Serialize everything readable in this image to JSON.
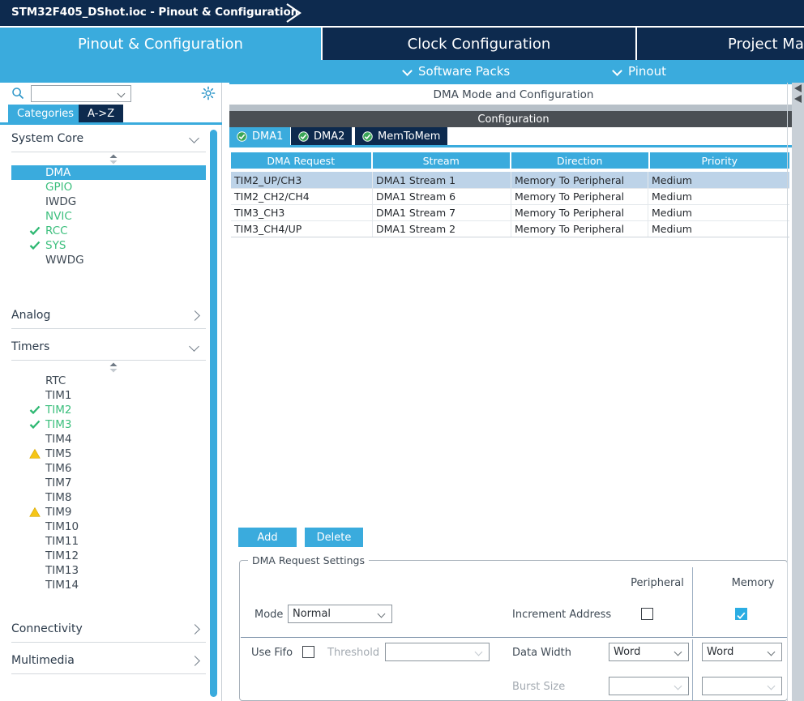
{
  "window": {
    "title": "STM32F405_DShot.ioc - Pinout & Configuration",
    "breadcrumb_icon": "chevron-right-icon"
  },
  "colors": {
    "brand_blue": "#3aabdd",
    "navy": "#0d2a4e",
    "selected_row": "#bdd3e8",
    "ok_green": "#3cbf7d",
    "warn_yellow": "#f5c518",
    "checkbox_checked": "#2bade3"
  },
  "main_tabs": [
    {
      "label": "Pinout & Configuration",
      "active": true
    },
    {
      "label": "Clock Configuration",
      "active": false
    },
    {
      "label": "Project Ma",
      "active": false
    }
  ],
  "sub_bar": [
    {
      "label": "Software Packs",
      "icon": "chevron-down-icon"
    },
    {
      "label": "Pinout",
      "icon": "chevron-down-icon"
    }
  ],
  "sidebar": {
    "search": {
      "value": "",
      "placeholder": "",
      "icon": "search-icon",
      "caret": "chevron-down-icon"
    },
    "settings_icon": "gear-icon",
    "view_tabs": [
      {
        "label": "Categories",
        "active": true
      },
      {
        "label": "A->Z",
        "active": false
      }
    ],
    "groups": [
      {
        "title": "System Core",
        "expanded": true,
        "chevron": "chevron-down-icon",
        "items": [
          {
            "label": "DMA",
            "status": "selected",
            "selected": true
          },
          {
            "label": "GPIO",
            "status": "configured-green"
          },
          {
            "label": "IWDG",
            "status": "none"
          },
          {
            "label": "NVIC",
            "status": "configured-green"
          },
          {
            "label": "RCC",
            "status": "ok-check"
          },
          {
            "label": "SYS",
            "status": "ok-check"
          },
          {
            "label": "WWDG",
            "status": "none"
          }
        ]
      },
      {
        "title": "Analog",
        "expanded": false,
        "chevron": "chevron-right-icon",
        "items": []
      },
      {
        "title": "Timers",
        "expanded": true,
        "chevron": "chevron-down-icon",
        "items": [
          {
            "label": "RTC",
            "status": "none"
          },
          {
            "label": "TIM1",
            "status": "none"
          },
          {
            "label": "TIM2",
            "status": "ok-check"
          },
          {
            "label": "TIM3",
            "status": "ok-check"
          },
          {
            "label": "TIM4",
            "status": "none"
          },
          {
            "label": "TIM5",
            "status": "warning"
          },
          {
            "label": "TIM6",
            "status": "none"
          },
          {
            "label": "TIM7",
            "status": "none"
          },
          {
            "label": "TIM8",
            "status": "none"
          },
          {
            "label": "TIM9",
            "status": "warning"
          },
          {
            "label": "TIM10",
            "status": "none"
          },
          {
            "label": "TIM11",
            "status": "none"
          },
          {
            "label": "TIM12",
            "status": "none"
          },
          {
            "label": "TIM13",
            "status": "none"
          },
          {
            "label": "TIM14",
            "status": "none"
          }
        ]
      },
      {
        "title": "Connectivity",
        "expanded": false,
        "chevron": "chevron-right-icon",
        "items": []
      },
      {
        "title": "Multimedia",
        "expanded": false,
        "chevron": "chevron-right-icon",
        "items": []
      }
    ]
  },
  "main": {
    "mode_title": "DMA Mode and Configuration",
    "config_title": "Configuration",
    "dma_tabs": [
      {
        "label": "DMA1",
        "active": true,
        "icon": "green-check-circle-icon"
      },
      {
        "label": "DMA2",
        "active": false,
        "icon": "green-check-circle-icon"
      },
      {
        "label": "MemToMem",
        "active": false,
        "icon": "green-check-circle-icon"
      }
    ],
    "table": {
      "headers": [
        "DMA Request",
        "Stream",
        "Direction",
        "Priority"
      ],
      "rows": [
        {
          "cells": [
            "TIM2_UP/CH3",
            "DMA1 Stream 1",
            "Memory To Peripheral",
            "Medium"
          ],
          "selected": true
        },
        {
          "cells": [
            "TIM2_CH2/CH4",
            "DMA1 Stream 6",
            "Memory To Peripheral",
            "Medium"
          ],
          "selected": false
        },
        {
          "cells": [
            "TIM3_CH3",
            "DMA1 Stream 7",
            "Memory To Peripheral",
            "Medium"
          ],
          "selected": false
        },
        {
          "cells": [
            "TIM3_CH4/UP",
            "DMA1 Stream 2",
            "Memory To Peripheral",
            "Medium"
          ],
          "selected": false
        }
      ]
    },
    "buttons": {
      "add": "Add",
      "delete": "Delete"
    },
    "settings": {
      "legend": "DMA Request Settings",
      "col_peripheral": "Peripheral",
      "col_memory": "Memory",
      "mode_label": "Mode",
      "mode_value": "Normal",
      "increment_label": "Increment Address",
      "increment_peripheral_checked": false,
      "increment_memory_checked": true,
      "usefifo_label": "Use Fifo",
      "usefifo_checked": false,
      "threshold_label": "Threshold",
      "threshold_value": "",
      "threshold_disabled": true,
      "datawidth_label": "Data Width",
      "datawidth_peripheral": "Word",
      "datawidth_memory": "Word",
      "burstsize_label": "Burst Size",
      "burstsize_peripheral": "",
      "burstsize_memory": "",
      "burstsize_disabled": true
    }
  }
}
